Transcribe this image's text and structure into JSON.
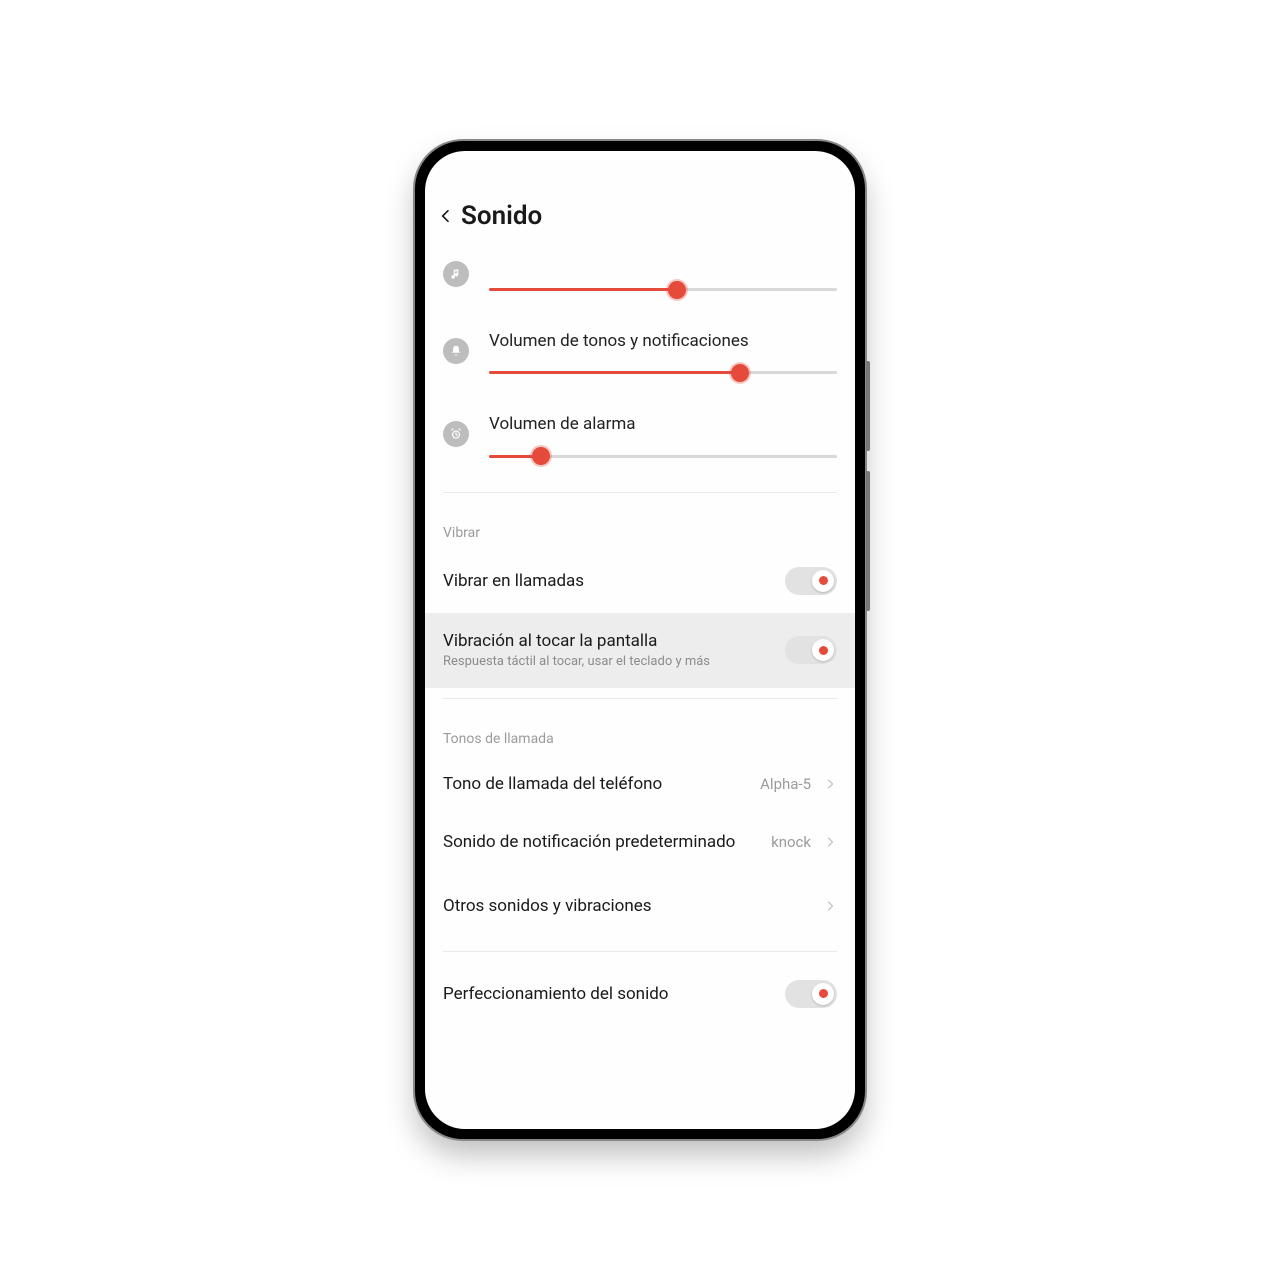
{
  "header": {
    "title": "Sonido"
  },
  "sliders": {
    "media": {
      "percent": 54
    },
    "ringtone": {
      "label": "Volumen de tonos y notificaciones",
      "percent": 72
    },
    "alarm": {
      "label": "Volumen de alarma",
      "percent": 15
    }
  },
  "sections": {
    "vibrate": {
      "header": "Vibrar",
      "vibrate_calls": {
        "title": "Vibrar en llamadas",
        "on": true
      },
      "vibrate_touch": {
        "title": "Vibración al tocar la pantalla",
        "subtitle": "Respuesta táctil al tocar, usar el teclado y más",
        "on": true
      }
    },
    "ringtones": {
      "header": "Tonos de llamada",
      "phone_ringtone": {
        "title": "Tono de llamada del teléfono",
        "value": "Alpha-5"
      },
      "default_notification": {
        "title": "Sonido de notificación predeterminado",
        "value": "knock"
      },
      "other_sounds": {
        "title": "Otros sonidos y vibraciones"
      }
    },
    "enhancement": {
      "title": "Perfeccionamiento del sonido",
      "on": true
    }
  },
  "colors": {
    "accent": "#e64a3b",
    "muted_icon": "#bdbdbd"
  }
}
